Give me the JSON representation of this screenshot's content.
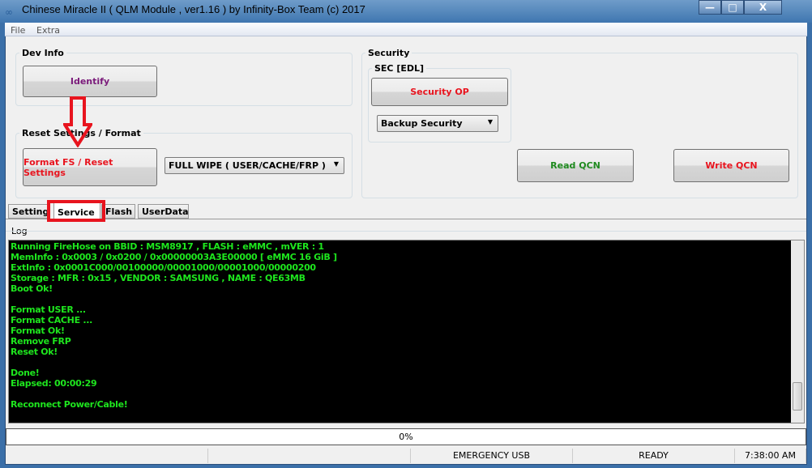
{
  "window": {
    "title": "Chinese Miracle II ( QLM Module , ver1.16  ) by Infinity-Box Team (c) 2017",
    "minimize": "—",
    "maximize": "□",
    "close": "X"
  },
  "menu": [
    "File",
    "Extra"
  ],
  "dev_info": {
    "label": "Dev Info",
    "identify": "Identify"
  },
  "reset": {
    "label": "Reset Settings / Format",
    "format_button": "Format FS / Reset Settings",
    "mode": "FULL WIPE ( USER/CACHE/FRP )"
  },
  "security": {
    "label": "Security",
    "sec_label": "SEC [EDL]",
    "security_op": "Security OP",
    "backup": "Backup Security",
    "read_qcn": "Read QCN",
    "write_qcn": "Write QCN"
  },
  "tabs": [
    "Settings",
    "Service",
    "Flash",
    "UserData"
  ],
  "active_tab": "Service",
  "log": {
    "label": "Log",
    "lines": [
      "Running FireHose on BBID : MSM8917 , FLASH : eMMC , mVER : 1",
      "MemInfo : 0x0003 / 0x0200 / 0x00000003A3E00000 [ eMMC 16 GiB ]",
      "ExtInfo : 0x0001C000/00100000/00001000/00001000/00000200",
      "Storage : MFR : 0x15 , VENDOR : SAMSUNG , NAME : QE63MB",
      "Boot Ok!",
      "",
      "Format USER ...",
      "Format CACHE ...",
      "Format Ok!",
      "Remove FRP",
      "Reset Ok!",
      "",
      "Done!",
      "Elapsed: 00:00:29",
      "",
      "Reconnect Power/Cable!"
    ]
  },
  "progress": {
    "text": "0%",
    "value": 0
  },
  "status": [
    "",
    "",
    "EMERGENCY USB",
    "READY",
    "7:38:00 AM"
  ],
  "colors": {
    "identify": "#7a1a7a",
    "red": "#e8141e",
    "green": "#1f8a1f",
    "log_text": "#1ee61e",
    "annotation": "#e8141e"
  }
}
